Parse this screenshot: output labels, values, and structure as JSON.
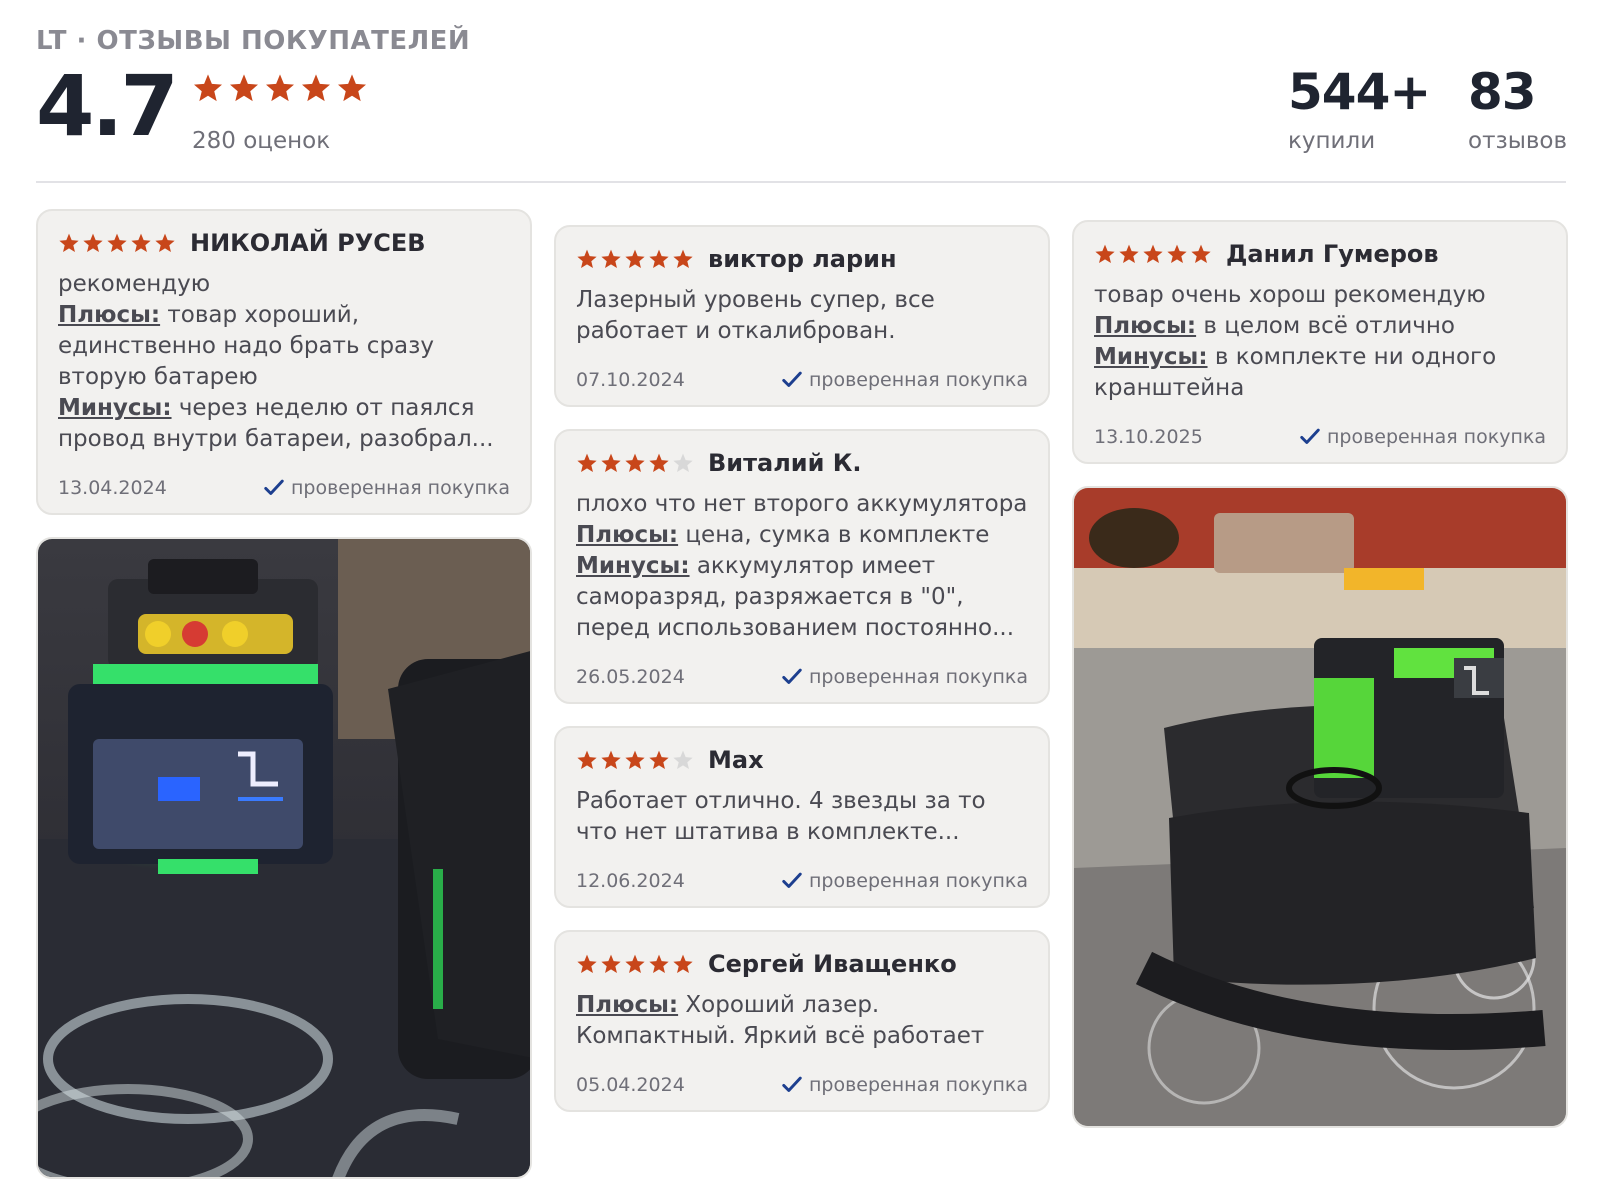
{
  "header": {
    "brand_line": "LT · ОТЗЫВЫ ПОКУПАТЕЛЕЙ",
    "average_rating": "4.7",
    "average_rating_value": 4.7,
    "rating_count_text": "280 оценок",
    "bought_count": "544+",
    "bought_label": "купили",
    "reviews_count": "83",
    "reviews_label": "отзывов"
  },
  "colors": {
    "star_filled": "#c8461a",
    "star_empty": "#d8d8d8",
    "check": "#1d3f8f",
    "card_bg": "#f2f1ef"
  },
  "reviews": [
    {
      "author": "НИКОЛАЙ РУСЕВ",
      "stars": 5,
      "text": "рекомендую",
      "pros_label": "Плюсы:",
      "pros": " товар хороший, единственно надо брать сразу вторую батарею",
      "cons_label": "Минусы:",
      "cons": " через неделю от паялся провод внутри батареи, разобрал...",
      "date": "13.04.2024",
      "verified": "проверенная покупка",
      "photo_icon": "laser-level-photo"
    },
    {
      "author": "виктор ларин",
      "stars": 5,
      "text": "Лазерный уровень супер, все работает и откалиброван.",
      "date": "07.10.2024",
      "verified": "проверенная покупка"
    },
    {
      "author": "Виталий К.",
      "stars": 4,
      "text": "плохо что нет второго аккумулятора",
      "pros_label": "Плюсы:",
      "pros": " цена, сумка в комплекте",
      "cons_label": "Минусы:",
      "cons": " аккумулятор имеет саморазряд, разряжается в \"0\", перед использованием постоянно...",
      "date": "26.05.2024",
      "verified": "проверенная покупка"
    },
    {
      "author": "Max",
      "stars": 4,
      "text": "Работает отлично. 4 звезды за то что нет штатива в комплекте...",
      "date": "12.06.2024",
      "verified": "проверенная покупка"
    },
    {
      "author": "Сергей Иващенко",
      "stars": 5,
      "pros_label": "Плюсы:",
      "pros": " Хороший лазер. Компактный. Яркий всё работает",
      "date": "05.04.2024",
      "verified": "проверенная покупка"
    },
    {
      "author": "Данил Гумеров",
      "stars": 5,
      "text": "товар очень хорош рекомендую",
      "pros_label": "Плюсы:",
      "pros": " в целом всё отлично",
      "cons_label": "Минусы:",
      "cons": " в комплекте ни одного кранштейна",
      "date": "13.10.2025",
      "verified": "проверенная покупка",
      "photo_icon": "laser-level-in-bag-photo"
    }
  ]
}
